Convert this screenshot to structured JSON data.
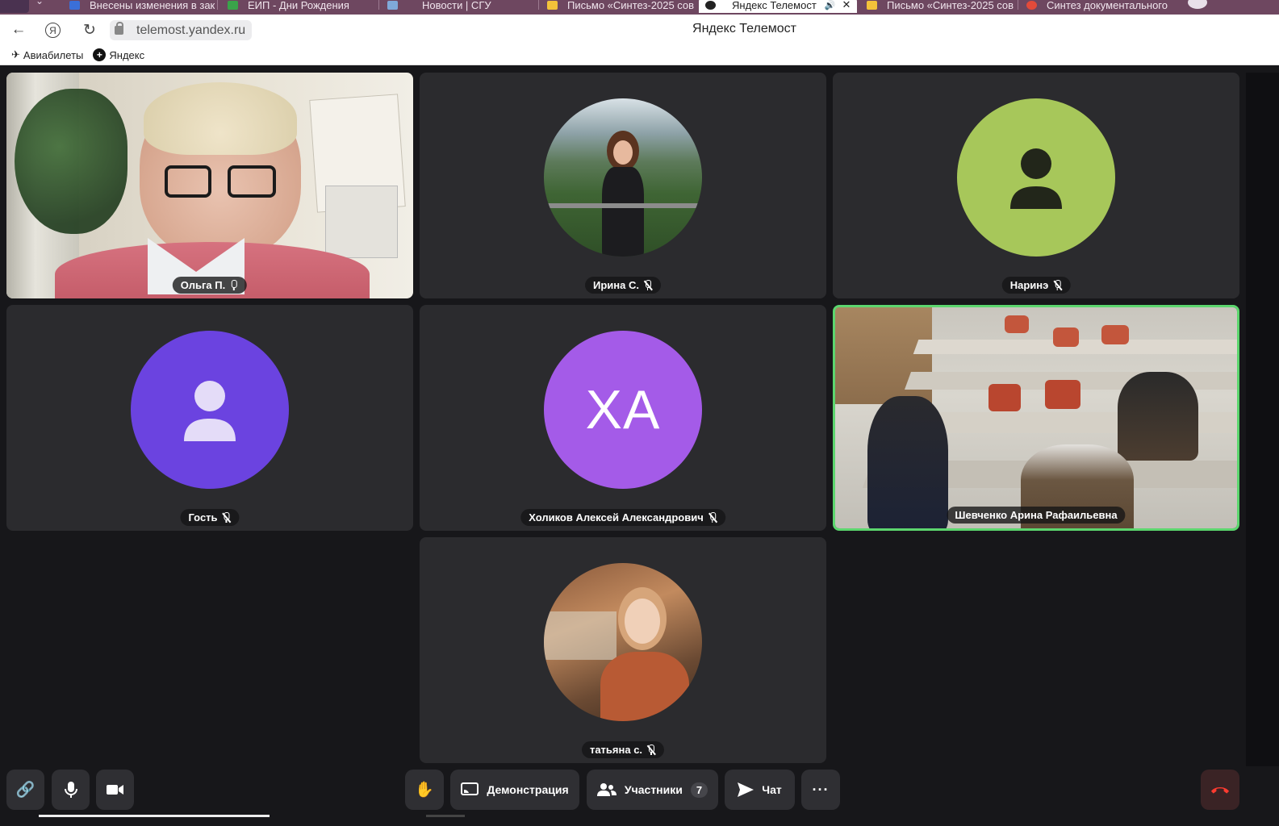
{
  "browser": {
    "tabs": [
      {
        "title": "Внесены изменения в зак",
        "fav": "#3b6fd8"
      },
      {
        "title": "ЕИП - Дни Рождения",
        "fav": "#3aa34a"
      },
      {
        "title": "Новости | СГУ",
        "fav": "#7fa9d9"
      },
      {
        "title": "Письмо «Синтез-2025 сов",
        "fav": "#f3c23a"
      },
      {
        "title": "Яндекс Телемост",
        "fav": "#222222"
      },
      {
        "title": "Письмо «Синтез-2025 сов",
        "fav": "#f3c23a"
      },
      {
        "title": "Синтез документального",
        "fav": "#e34a3a"
      }
    ],
    "url": "telemost.yandex.ru",
    "page_title": "Яндекс Телемост",
    "bookmarks": [
      {
        "label": "Авиабилеты",
        "icon": "airplane-icon"
      },
      {
        "label": "Яндекс",
        "icon": "yandex-icon"
      }
    ]
  },
  "participants": [
    {
      "name": "Ольга П.",
      "mic": "on",
      "kind": "video"
    },
    {
      "name": "Ирина С.",
      "mic": "muted",
      "kind": "photo"
    },
    {
      "name": "Наринэ",
      "mic": "muted",
      "kind": "placeholder",
      "color": "#a7c75a"
    },
    {
      "name": "Гость",
      "mic": "muted",
      "kind": "placeholder",
      "color": "#6b43e0"
    },
    {
      "name": "Холиков Алексей Александрович",
      "mic": "muted",
      "kind": "initials",
      "initials": "ХА",
      "color": "#a45be8"
    },
    {
      "name": "Шевченко Арина Рафаильевна",
      "mic": "none",
      "kind": "video",
      "speaking": true
    },
    {
      "name": "татьяна с.",
      "mic": "muted",
      "kind": "photo"
    }
  ],
  "toolbar": {
    "share_label": "Демонстрация",
    "participants_label": "Участники",
    "participants_count": "7",
    "chat_label": "Чат",
    "more_label": "···"
  },
  "colors": {
    "speaking_border": "#5cd66e",
    "hangup": "#ff3b30"
  }
}
